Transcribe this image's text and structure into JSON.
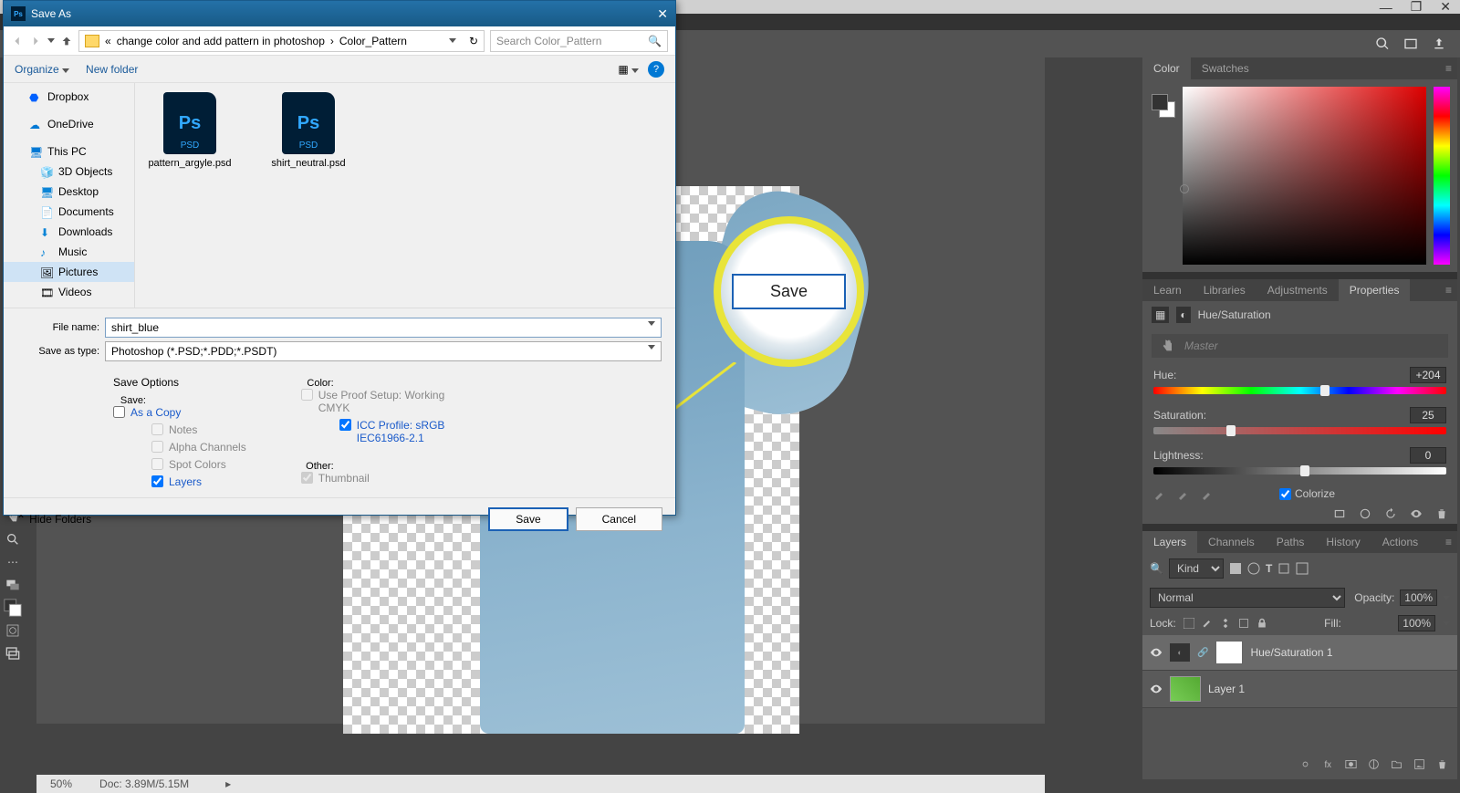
{
  "ps_window": {
    "min": "—",
    "restore": "❐",
    "close": "✕"
  },
  "topbar_icons": {
    "search": "search",
    "arrange": "arrange",
    "share": "share"
  },
  "statusbar": {
    "zoom": "50%",
    "doc_info": "Doc: 3.89M/5.15M"
  },
  "panels": {
    "color_tab": "Color",
    "swatches_tab": "Swatches",
    "learn_tab": "Learn",
    "libraries_tab": "Libraries",
    "adjustments_tab": "Adjustments",
    "properties_tab": "Properties",
    "layers_tab": "Layers",
    "channels_tab": "Channels",
    "paths_tab": "Paths",
    "history_tab": "History",
    "actions_tab": "Actions"
  },
  "properties": {
    "title": "Hue/Saturation",
    "master": "Master",
    "hue_label": "Hue:",
    "hue_value": "+204",
    "sat_label": "Saturation:",
    "sat_value": "25",
    "light_label": "Lightness:",
    "light_value": "0",
    "colorize": "Colorize"
  },
  "layers": {
    "kind_label": "Kind",
    "blend_mode": "Normal",
    "opacity_label": "Opacity:",
    "opacity_value": "100%",
    "lock_label": "Lock:",
    "fill_label": "Fill:",
    "fill_value": "100%",
    "items": [
      {
        "name": "Hue/Saturation 1",
        "type": "adj"
      },
      {
        "name": "Layer 1",
        "type": "pixel"
      }
    ]
  },
  "zoom_callout": {
    "save": "Save"
  },
  "dialog": {
    "title": "Save As",
    "breadcrumb": {
      "ellipsis": "«",
      "folder1": "change color and add pattern in photoshop",
      "folder2": "Color_Pattern"
    },
    "search_placeholder": "Search Color_Pattern",
    "organize": "Organize",
    "new_folder": "New folder",
    "nav_items": [
      {
        "name": "Dropbox",
        "icon": "dropbox"
      },
      {
        "name": "OneDrive",
        "icon": "onedrive"
      },
      {
        "name": "This PC",
        "icon": "pc"
      },
      {
        "name": "3D Objects",
        "icon": "3d",
        "sub": true
      },
      {
        "name": "Desktop",
        "icon": "desktop",
        "sub": true
      },
      {
        "name": "Documents",
        "icon": "docs",
        "sub": true
      },
      {
        "name": "Downloads",
        "icon": "downloads",
        "sub": true
      },
      {
        "name": "Music",
        "icon": "music",
        "sub": true
      },
      {
        "name": "Pictures",
        "icon": "pictures",
        "sub": true,
        "selected": true
      },
      {
        "name": "Videos",
        "icon": "videos",
        "sub": true
      }
    ],
    "files": [
      {
        "name": "pattern_argyle.psd"
      },
      {
        "name": "shirt_neutral.psd"
      }
    ],
    "file_name_label": "File name:",
    "file_name_value": "shirt_blue",
    "save_type_label": "Save as type:",
    "save_type_value": "Photoshop (*.PSD;*.PDD;*.PSDT)",
    "save_options_title": "Save Options",
    "save_label": "Save:",
    "opt_as_copy": "As a Copy",
    "opt_notes": "Notes",
    "opt_alpha": "Alpha Channels",
    "opt_spot": "Spot Colors",
    "opt_layers": "Layers",
    "color_label": "Color:",
    "opt_proof": "Use Proof Setup: Working CMYK",
    "opt_icc": "ICC Profile:  sRGB IEC61966-2.1",
    "other_label": "Other:",
    "opt_thumbnail": "Thumbnail",
    "hide_folders": "Hide Folders",
    "btn_save": "Save",
    "btn_cancel": "Cancel"
  }
}
